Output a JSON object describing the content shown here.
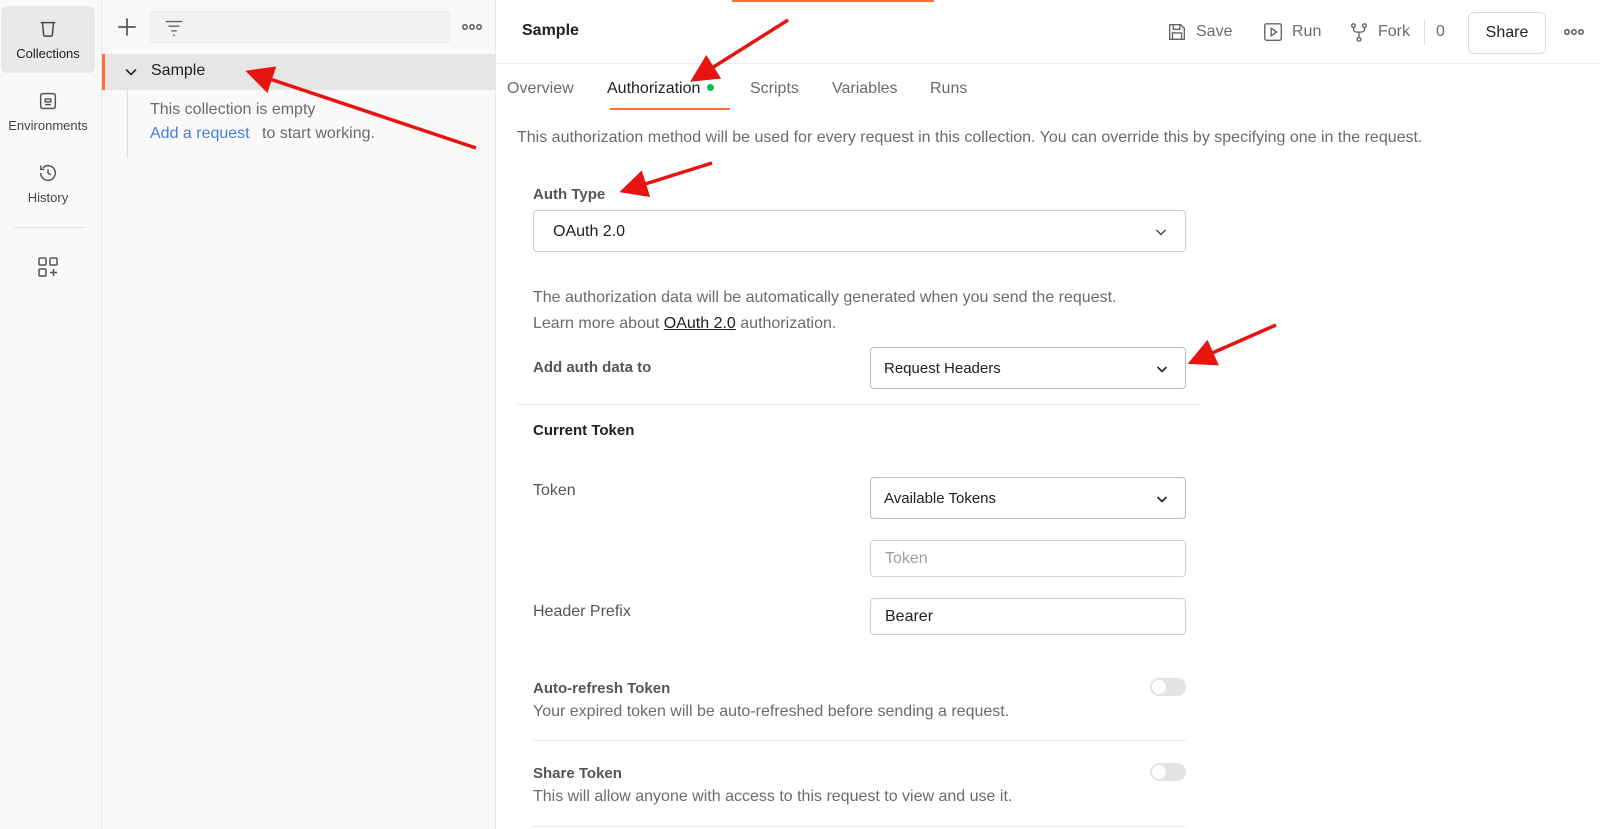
{
  "rail": {
    "collections_label": "Collections",
    "environments_label": "Environments",
    "history_label": "History"
  },
  "sidebar": {
    "collection_name": "Sample",
    "empty_text": "This collection is empty",
    "add_request_link": "Add a request",
    "add_request_suffix": "to start working."
  },
  "header": {
    "title": "Sample",
    "save_label": "Save",
    "run_label": "Run",
    "fork_label": "Fork",
    "fork_count": "0",
    "share_label": "Share"
  },
  "tabs": [
    {
      "label": "Overview"
    },
    {
      "label": "Authorization"
    },
    {
      "label": "Scripts"
    },
    {
      "label": "Variables"
    },
    {
      "label": "Runs"
    }
  ],
  "auth": {
    "description": "This authorization method will be used for every request in this collection. You can override this by specifying one in the request.",
    "auth_type_label": "Auth Type",
    "auth_type_value": "OAuth 2.0",
    "info_line1": "The authorization data will be automatically generated when you send the request.",
    "info_line2_prefix": "Learn more about",
    "info_line2_link": "OAuth 2.0",
    "info_line2_suffix": "authorization.",
    "add_auth_label": "Add auth data to",
    "add_auth_value": "Request Headers",
    "current_token_heading": "Current Token",
    "token_label": "Token",
    "token_select_value": "Available Tokens",
    "token_input_placeholder": "Token",
    "header_prefix_label": "Header Prefix",
    "header_prefix_value": "Bearer",
    "auto_refresh_title": "Auto-refresh Token",
    "auto_refresh_desc": "Your expired token will be auto-refreshed before sending a request.",
    "share_token_title": "Share Token",
    "share_token_desc": "This will allow anyone with access to this request to view and use it."
  },
  "colors": {
    "accent": "#ff6c37",
    "link": "#4a7cdc",
    "status_dot": "#0cbb52",
    "annotation_arrow": "#e8140f"
  }
}
